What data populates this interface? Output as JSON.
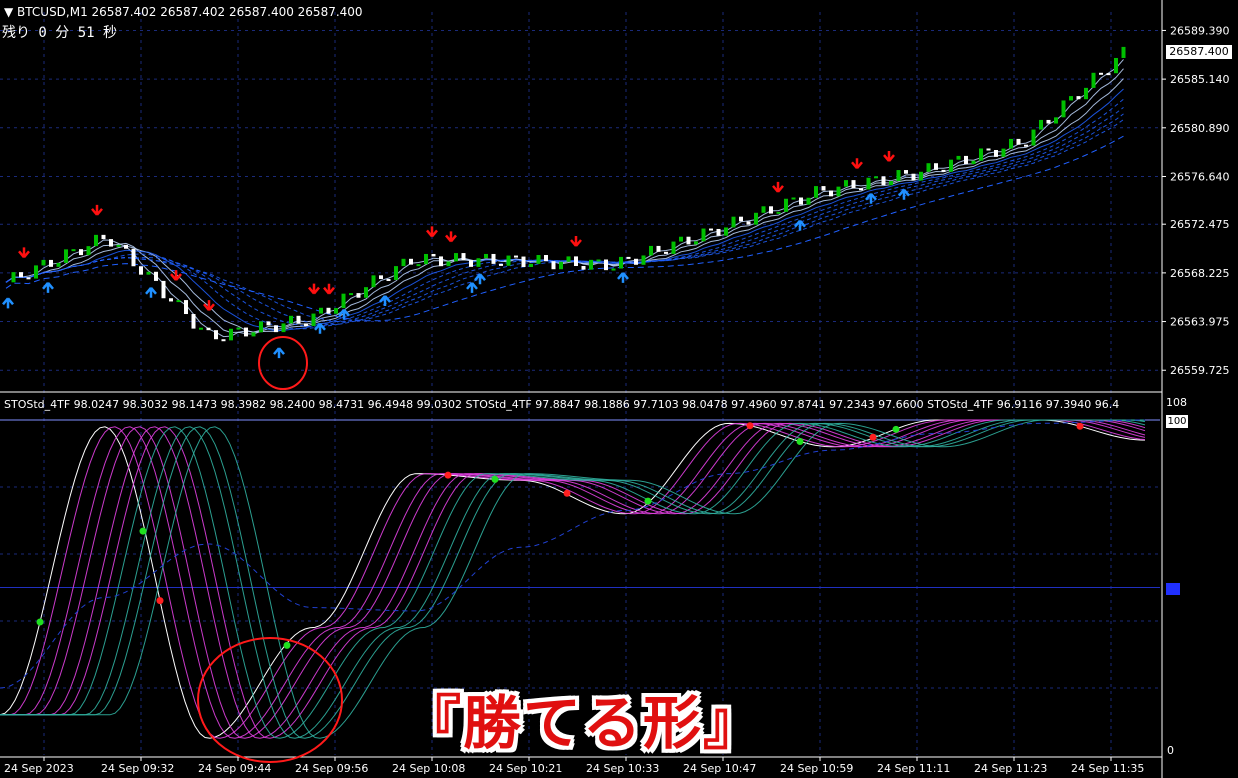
{
  "header": {
    "symbol_line": "▼ BTCUSD,M1  26587.402 26587.402 26587.400 26587.400",
    "countdown": "残り  0 分  51 秒"
  },
  "price_axis": {
    "current_price": "26587.400",
    "ticks": [
      "26589.390",
      "26585.140",
      "26580.890",
      "26576.640",
      "26572.475",
      "26568.225",
      "26563.975",
      "26559.725"
    ]
  },
  "indicator": {
    "title_line": "STOStd_4TF 98.0247 98.3032 98.1473 98.3982 98.2400 98.4731 96.4948 99.0302  STOStd_4TF 97.8847 98.1886 97.7103 98.0478 97.4960 97.8741 97.2343 97.6600  STOStd_4TF 96.9116 97.3940 96.4",
    "scale_top": "108",
    "scale_current": "100",
    "scale_bottom": "0"
  },
  "time_axis": {
    "labels": [
      "24 Sep 2023",
      "24 Sep 09:32",
      "24 Sep 09:44",
      "24 Sep 09:56",
      "24 Sep 10:08",
      "24 Sep 10:21",
      "24 Sep 10:33",
      "24 Sep 10:47",
      "24 Sep 10:59",
      "24 Sep 11:11",
      "24 Sep 11:23",
      "24 Sep 11:35"
    ]
  },
  "banner": {
    "text": "『勝てる形』"
  },
  "colors": {
    "background": "#000000",
    "grid": "#1a2a7a",
    "bull_candle": "#00c000",
    "bear_candle": "#ffffff",
    "sell_arrow": "#ff1010",
    "buy_arrow": "#2090ff",
    "ribbon_red": "#ff2a1a",
    "ribbon_blue": "#2060ff",
    "stoch_magenta": "#e040e0",
    "stoch_teal": "#30b0a0",
    "circle_marker": "#ff1a1a"
  },
  "chart_data": [
    {
      "type": "candlestick",
      "title": "BTCUSD,M1",
      "x": [
        "24 Sep 2023",
        "24 Sep 09:32",
        "24 Sep 09:44",
        "24 Sep 09:56",
        "24 Sep 10:08",
        "24 Sep 10:21",
        "24 Sep 10:33",
        "24 Sep 10:47",
        "24 Sep 10:59",
        "24 Sep 11:11",
        "24 Sep 11:23",
        "24 Sep 11:35"
      ],
      "close": [
        26567.4,
        26571.4,
        26562.6,
        26564.2,
        26569.4,
        26569.3,
        26568.9,
        26572.0,
        26575.3,
        26577.0,
        26579.6,
        26587.4
      ],
      "ylim": [
        26558.0,
        26591.0
      ],
      "sell_arrows": 12,
      "buy_arrows": 13
    },
    {
      "type": "line",
      "title": "STOStd_4TF",
      "x": [
        "24 Sep 2023",
        "24 Sep 09:32",
        "24 Sep 09:44",
        "24 Sep 09:56",
        "24 Sep 10:08",
        "24 Sep 10:21",
        "24 Sep 10:33",
        "24 Sep 10:47",
        "24 Sep 10:59",
        "24 Sep 11:11",
        "24 Sep 11:23",
        "24 Sep 11:35"
      ],
      "series": [
        {
          "name": "fast",
          "values": [
            12,
            98,
            5,
            38,
            84,
            82,
            72,
            99,
            92,
            100,
            100,
            94
          ]
        },
        {
          "name": "slow",
          "values": [
            20,
            47,
            63,
            44,
            43,
            62,
            73,
            84,
            91,
            96,
            99,
            100
          ]
        }
      ],
      "ylim": [
        0,
        108
      ]
    }
  ]
}
